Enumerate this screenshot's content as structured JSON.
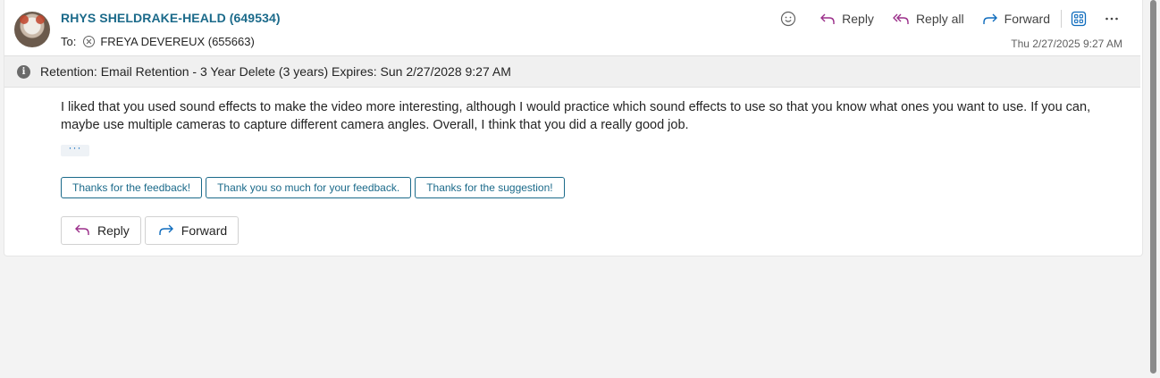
{
  "email": {
    "sender": "RHYS SHELDRAKE-HEALD (649534)",
    "to_label": "To:",
    "recipient": "FREYA DEVEREUX (655663)",
    "date": "Thu 2/27/2025 9:27 AM",
    "retention": "Retention: Email Retention - 3 Year Delete (3 years) Expires: Sun 2/27/2028 9:27 AM",
    "body": "I liked that you used sound effects to make the video more interesting, although I would practice which sound effects to use so that you know what ones you want to use. If you can, maybe use multiple cameras to capture different camera angles. Overall, I think that you did a really good job.",
    "ellipsis": "···"
  },
  "toolbar": {
    "reply_label": "Reply",
    "reply_all_label": "Reply all",
    "forward_label": "Forward"
  },
  "suggestions": [
    "Thanks for the feedback!",
    "Thank you so much for your feedback.",
    "Thanks for the suggestion!"
  ],
  "actions": {
    "reply_label": "Reply",
    "forward_label": "Forward"
  },
  "icons": {
    "emoji": "smile-icon",
    "reply": "reply-arrow-icon",
    "reply_all": "reply-all-arrow-icon",
    "forward": "forward-arrow-icon",
    "apps": "apps-grid-icon",
    "more": "more-horizontal-icon",
    "info": "info-icon"
  },
  "colors": {
    "accent": "#1b6a8a",
    "reply_icon": "#9b2f8a",
    "forward_icon": "#0f6cbd"
  }
}
